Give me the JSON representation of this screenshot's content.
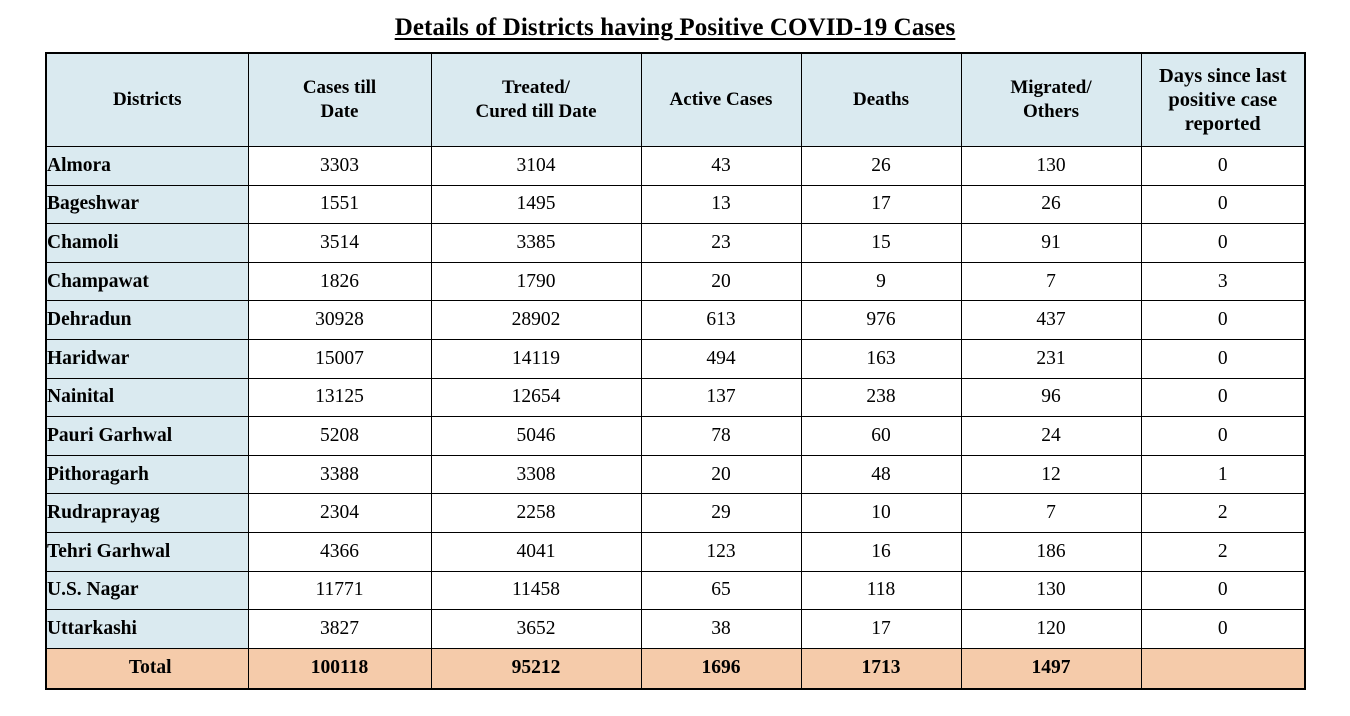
{
  "document": {
    "title": "Details of Districts having Positive COVID-19 Cases"
  },
  "colors": {
    "header_bg": "#daeaf0",
    "district_bg": "#daeaf0",
    "total_bg": "#f5cbaa",
    "cell_bg": "#ffffff",
    "border": "#000000",
    "text": "#000000"
  },
  "table": {
    "columns": [
      {
        "key": "district",
        "label": "Districts"
      },
      {
        "key": "cases_till_date",
        "label": "Cases till\nDate",
        "line1": "Cases till",
        "line2": "Date"
      },
      {
        "key": "treated_cured",
        "label": "Treated/\nCured till Date",
        "line1": "Treated/",
        "line2": "Cured till Date"
      },
      {
        "key": "active_cases",
        "label": "Active Cases"
      },
      {
        "key": "deaths",
        "label": "Deaths"
      },
      {
        "key": "migrated_others",
        "label": "Migrated/\nOthers",
        "line1": "Migrated/",
        "line2": "Others"
      },
      {
        "key": "days_since_last",
        "label": "Days since last positive case reported",
        "line1": "Days since last",
        "line2": "positive case",
        "line3": "reported"
      }
    ],
    "rows": [
      {
        "district": "Almora",
        "cases_till_date": "3303",
        "treated_cured": "3104",
        "active_cases": "43",
        "deaths": "26",
        "migrated_others": "130",
        "days_since_last": "0"
      },
      {
        "district": "Bageshwar",
        "cases_till_date": "1551",
        "treated_cured": "1495",
        "active_cases": "13",
        "deaths": "17",
        "migrated_others": "26",
        "days_since_last": "0"
      },
      {
        "district": "Chamoli",
        "cases_till_date": "3514",
        "treated_cured": "3385",
        "active_cases": "23",
        "deaths": "15",
        "migrated_others": "91",
        "days_since_last": "0"
      },
      {
        "district": "Champawat",
        "cases_till_date": "1826",
        "treated_cured": "1790",
        "active_cases": "20",
        "deaths": "9",
        "migrated_others": "7",
        "days_since_last": "3"
      },
      {
        "district": "Dehradun",
        "cases_till_date": "30928",
        "treated_cured": "28902",
        "active_cases": "613",
        "deaths": "976",
        "migrated_others": "437",
        "days_since_last": "0"
      },
      {
        "district": "Haridwar",
        "cases_till_date": "15007",
        "treated_cured": "14119",
        "active_cases": "494",
        "deaths": "163",
        "migrated_others": "231",
        "days_since_last": "0"
      },
      {
        "district": "Nainital",
        "cases_till_date": "13125",
        "treated_cured": "12654",
        "active_cases": "137",
        "deaths": "238",
        "migrated_others": "96",
        "days_since_last": "0"
      },
      {
        "district": "Pauri Garhwal",
        "cases_till_date": "5208",
        "treated_cured": "5046",
        "active_cases": "78",
        "deaths": "60",
        "migrated_others": "24",
        "days_since_last": "0"
      },
      {
        "district": "Pithoragarh",
        "cases_till_date": "3388",
        "treated_cured": "3308",
        "active_cases": "20",
        "deaths": "48",
        "migrated_others": "12",
        "days_since_last": "1"
      },
      {
        "district": "Rudraprayag",
        "cases_till_date": "2304",
        "treated_cured": "2258",
        "active_cases": "29",
        "deaths": "10",
        "migrated_others": "7",
        "days_since_last": "2"
      },
      {
        "district": "Tehri Garhwal",
        "cases_till_date": "4366",
        "treated_cured": "4041",
        "active_cases": "123",
        "deaths": "16",
        "migrated_others": "186",
        "days_since_last": "2"
      },
      {
        "district": "U.S. Nagar",
        "cases_till_date": "11771",
        "treated_cured": "11458",
        "active_cases": "65",
        "deaths": "118",
        "migrated_others": "130",
        "days_since_last": "0"
      },
      {
        "district": "Uttarkashi",
        "cases_till_date": "3827",
        "treated_cured": "3652",
        "active_cases": "38",
        "deaths": "17",
        "migrated_others": "120",
        "days_since_last": "0"
      }
    ],
    "total": {
      "district": "Total",
      "cases_till_date": "100118",
      "treated_cured": "95212",
      "active_cases": "1696",
      "deaths": "1713",
      "migrated_others": "1497",
      "days_since_last": ""
    }
  }
}
